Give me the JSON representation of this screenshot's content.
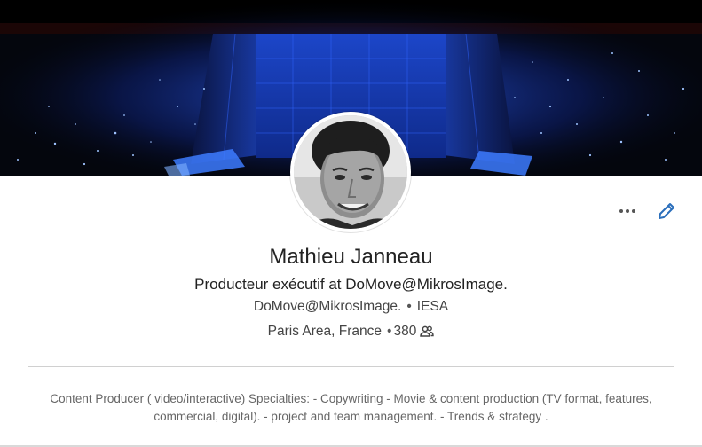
{
  "profile": {
    "name": "Mathieu Janneau",
    "headline": "Producteur exécutif at DoMove@MikrosImage.",
    "company": "DoMove@MikrosImage.",
    "school": "IESA",
    "location": "Paris Area, France",
    "connections": "380",
    "summary": "Content Producer ( video/interactive) Specialties: - Copywriting - Movie & content production (TV format, features, commercial, digital). - project and team management. - Trends & strategy ."
  },
  "icons": {
    "more": "more-horizontal-icon",
    "edit": "pencil-icon",
    "connections": "people-icon"
  },
  "colors": {
    "accent": "#2a6ebb",
    "cover_blue": "#1e4fd0",
    "text_dark": "#222222",
    "text_muted": "#666666"
  }
}
